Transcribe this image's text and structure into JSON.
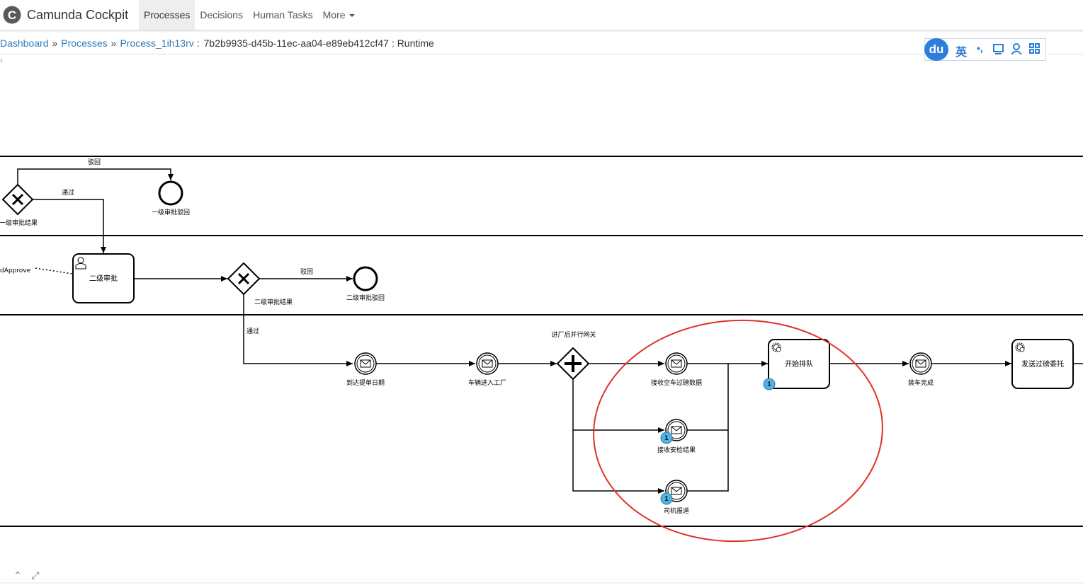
{
  "header": {
    "brand_letter": "C",
    "app_title": "Camunda Cockpit",
    "nav": [
      {
        "label": "Processes",
        "active": true
      },
      {
        "label": "Decisions",
        "active": false
      },
      {
        "label": "Human Tasks",
        "active": false
      },
      {
        "label": "More",
        "active": false
      }
    ]
  },
  "breadcrumb": {
    "dashboard": "Dashboard",
    "sep": "»",
    "processes": "Processes",
    "process": "Process_1ih13rv",
    "colon": ":",
    "instance": "7b2b9935-d45b-11ec-aa04-e89eb412cf47",
    "view": ": Runtime"
  },
  "input_method_bar": {
    "logo": "du",
    "lang": "英",
    "punct": "•,"
  },
  "diagram": {
    "lane1": {
      "gateway_label": "一级审批结果",
      "reject_label": "驳回",
      "pass_label": "通过",
      "end_label": "一级审批驳回"
    },
    "lane2": {
      "association_label": "dApprove",
      "task_label": "二级审批",
      "gateway_label": "二级审批结果",
      "reject_label": "驳回",
      "end_label": "二级审批驳回"
    },
    "lane3": {
      "pass_label": "通过",
      "event_arrive": "到达提单日期",
      "event_enter": "车辆进入工厂",
      "parallel_gateway": "进厂后并行网关",
      "event_empty_weight": "接收空车过磅数据",
      "event_security": "接收安检结果",
      "event_driver": "司机报道",
      "task_queue": "开始排队",
      "event_load_done": "装车完成",
      "task_weigh": "发送过磅委托",
      "badge_security": "1",
      "badge_driver": "1",
      "badge_queue": "1"
    },
    "highlight_color": "#e0312a",
    "badge_color": "#52b2e0"
  },
  "controls": {
    "collapse": "⌃",
    "fullscreen": "⤢"
  }
}
